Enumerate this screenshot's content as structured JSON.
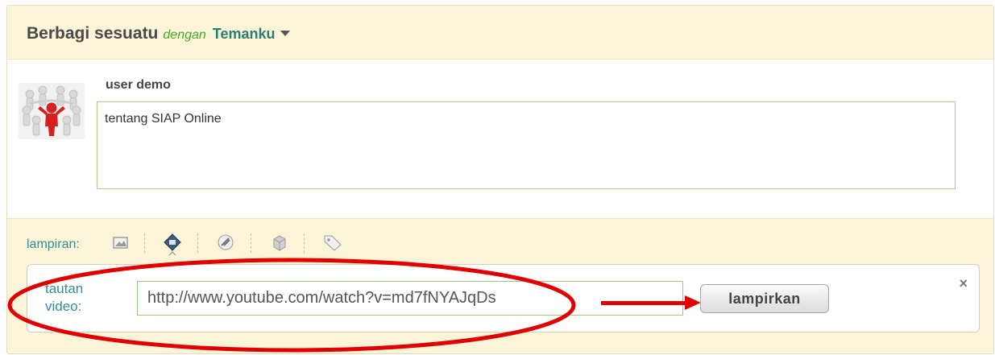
{
  "header": {
    "title": "Berbagi sesuatu",
    "with": "dengan",
    "audience": "Temanku"
  },
  "post": {
    "username": "user demo",
    "text": "tentang SIAP Online"
  },
  "attachments": {
    "label": "lampiran:",
    "icons": [
      "image-icon",
      "video-icon",
      "link-icon",
      "file-icon",
      "tag-icon"
    ],
    "active": "video-icon"
  },
  "video": {
    "label": "tautan video:",
    "url": "http://www.youtube.com/watch?v=md7fNYAJqDs",
    "button": "lampirkan",
    "close": "×"
  },
  "colors": {
    "accent_green": "#47a625",
    "teal": "#2b7d72",
    "annotation_red": "#e10000",
    "panel_bg": "#fcf4d8"
  }
}
